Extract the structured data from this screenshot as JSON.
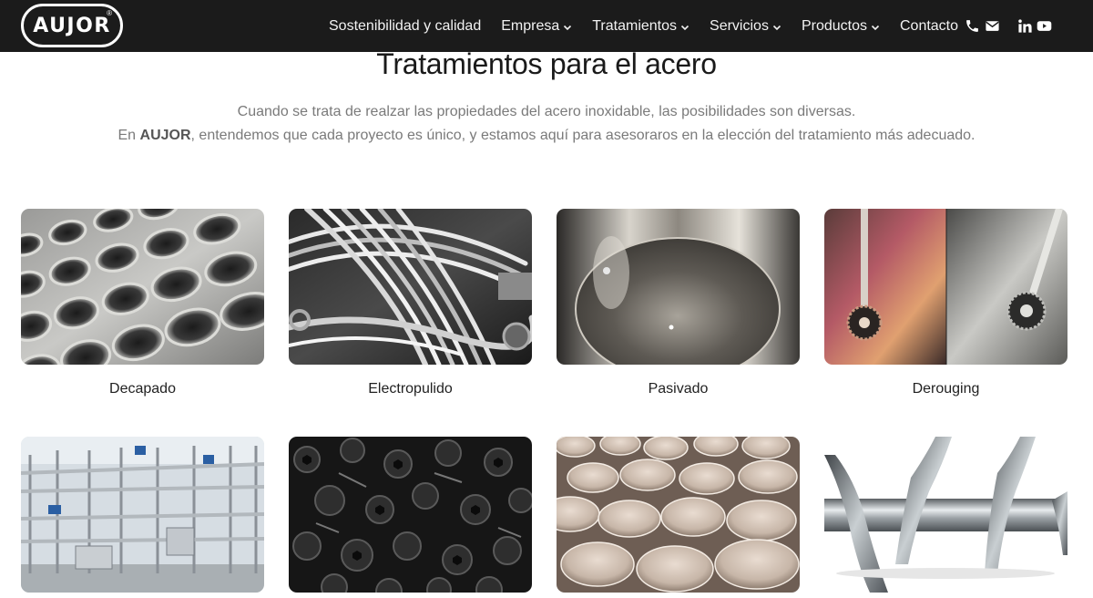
{
  "brand": {
    "logo_text": "AUJOR",
    "logo_mark": "®"
  },
  "nav": {
    "items": [
      {
        "label": "Sostenibilidad y calidad",
        "has_dropdown": false
      },
      {
        "label": "Empresa",
        "has_dropdown": true
      },
      {
        "label": "Tratamientos",
        "has_dropdown": true
      },
      {
        "label": "Servicios",
        "has_dropdown": true
      },
      {
        "label": "Productos",
        "has_dropdown": true
      },
      {
        "label": "Contacto",
        "has_dropdown": false
      }
    ],
    "icons": [
      "phone-icon",
      "mail-icon",
      "linkedin-icon",
      "youtube-icon"
    ]
  },
  "header": {
    "title": "Tratamientos para el acero",
    "intro_line1": "Cuando se trata de realzar las propiedades del acero inoxidable, las posibilidades son diversas.",
    "intro_line2_prefix": "En ",
    "intro_line2_brand": "AUJOR",
    "intro_line2_suffix": ", entendemos que cada proyecto es único, y estamos aquí para asesoraros en la elección del tratamiento más adecuado."
  },
  "treatments": [
    {
      "label": "Decapado",
      "image": "perforated-steel-plate"
    },
    {
      "label": "Electropulido",
      "image": "coiled-steel-tubes"
    },
    {
      "label": "Pasivado",
      "image": "polished-steel-tank-interior"
    },
    {
      "label": "Derouging",
      "image": "tank-agitator-before-after"
    },
    {
      "label": "",
      "image": "industrial-piping-plant"
    },
    {
      "label": "",
      "image": "black-screws-pile"
    },
    {
      "label": "",
      "image": "steel-bowls-stack"
    },
    {
      "label": "",
      "image": "steel-screw-conveyor"
    }
  ],
  "colors": {
    "navbar_bg": "#1b1b1b",
    "nav_text": "#f2f2f2",
    "title": "#1a1a1a",
    "intro_text": "#7a7a7a",
    "page_bg": "#ffffff"
  }
}
